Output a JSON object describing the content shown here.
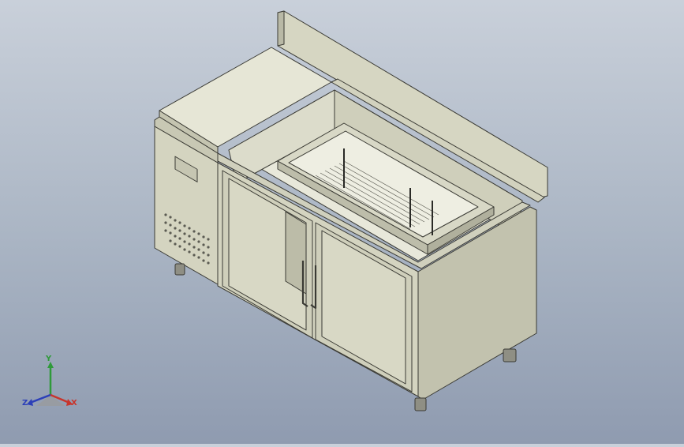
{
  "viewport": {
    "background_top": "#c9d0da",
    "background_bottom": "#8f9bb0",
    "model_color": "#d9d9c6",
    "edge_color": "#3a3a34"
  },
  "triad": {
    "x_label": "X",
    "y_label": "Y",
    "z_label": "Z",
    "x_color": "#c8352c",
    "y_color": "#2f9a3a",
    "z_color": "#2c3fb8"
  }
}
